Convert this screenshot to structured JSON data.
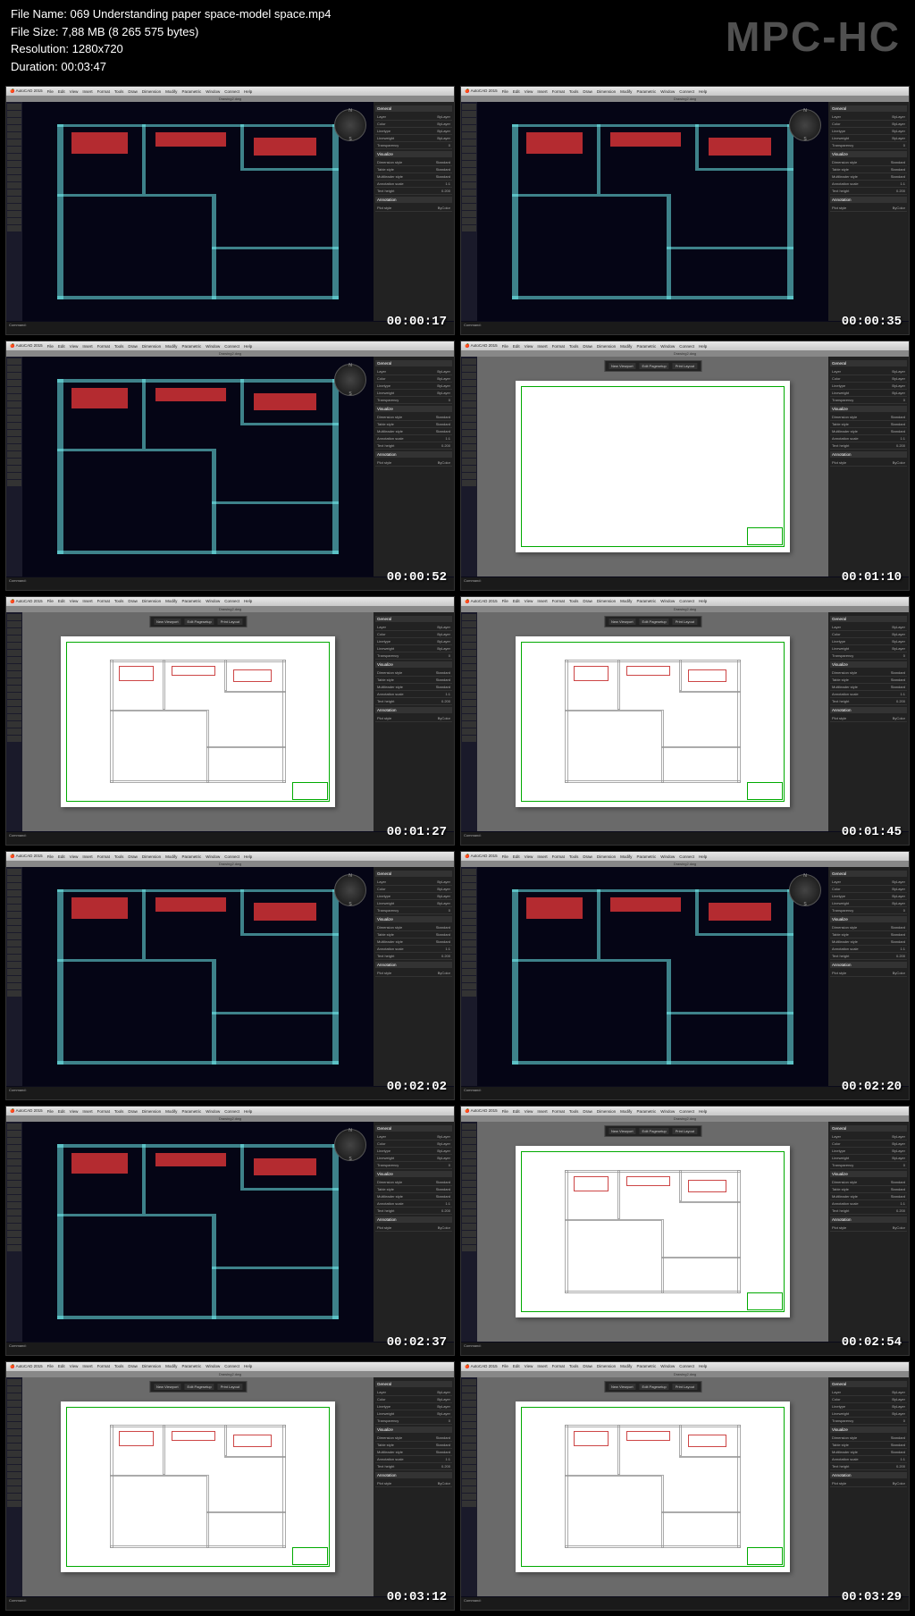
{
  "app": "MPC-HC",
  "header": {
    "filename_label": "File Name:",
    "filename": "069 Understanding paper space-model space.mp4",
    "filesize_label": "File Size:",
    "filesize": "7,88 MB (8 265 575 bytes)",
    "resolution_label": "Resolution:",
    "resolution": "1280x720",
    "duration_label": "Duration:",
    "duration": "00:03:47"
  },
  "autocad": {
    "app_name": "AutoCAD 2015",
    "menus": [
      "File",
      "Edit",
      "View",
      "Insert",
      "Format",
      "Tools",
      "Draw",
      "Dimension",
      "Modify",
      "Parametric",
      "Window",
      "Connect",
      "Help"
    ],
    "drawing_tab": "Drawing2.dwg",
    "cmd_prompt": "Command:",
    "layout_buttons": [
      "New Viewport",
      "Edit Pagesetup",
      "Print Layout"
    ],
    "panel_title": "Properties / Inspector",
    "panel_sections": [
      "General",
      "Visualize",
      "Annotation",
      "Plot style"
    ],
    "panel_rows": [
      {
        "k": "Layer",
        "v": "ByLayer"
      },
      {
        "k": "Color",
        "v": "ByLayer"
      },
      {
        "k": "Linetype",
        "v": "ByLayer"
      },
      {
        "k": "Lineweight",
        "v": "ByLayer"
      },
      {
        "k": "Transparency",
        "v": "0"
      },
      {
        "k": "Dimension style",
        "v": "Standard"
      },
      {
        "k": "Table style",
        "v": "Standard"
      },
      {
        "k": "Multileader style",
        "v": "Standard"
      },
      {
        "k": "Annotation scale",
        "v": "1:1"
      },
      {
        "k": "Text height",
        "v": "0.200"
      },
      {
        "k": "Plot style",
        "v": "ByColor"
      }
    ]
  },
  "thumbnails": [
    {
      "ts": "00:00:17",
      "mode": "model",
      "compass": true
    },
    {
      "ts": "00:00:35",
      "mode": "model",
      "compass": true
    },
    {
      "ts": "00:00:52",
      "mode": "model",
      "compass": true
    },
    {
      "ts": "00:01:10",
      "mode": "paper_empty",
      "compass": false
    },
    {
      "ts": "00:01:27",
      "mode": "paper_plan",
      "compass": false
    },
    {
      "ts": "00:01:45",
      "mode": "paper_plan",
      "compass": false
    },
    {
      "ts": "00:02:02",
      "mode": "model",
      "compass": true
    },
    {
      "ts": "00:02:20",
      "mode": "model",
      "compass": true
    },
    {
      "ts": "00:02:37",
      "mode": "model",
      "compass": true
    },
    {
      "ts": "00:02:54",
      "mode": "paper_plan",
      "compass": false
    },
    {
      "ts": "00:03:12",
      "mode": "paper_plan",
      "compass": false
    },
    {
      "ts": "00:03:29",
      "mode": "paper_plan",
      "compass": false
    }
  ]
}
